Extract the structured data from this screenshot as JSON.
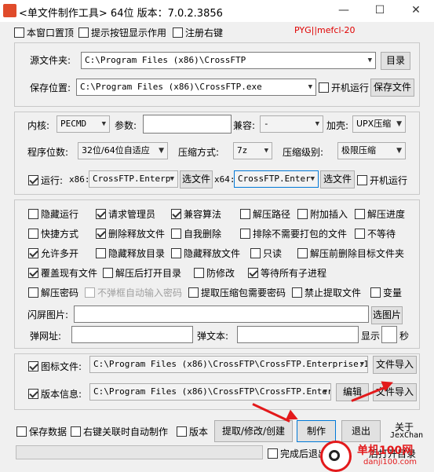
{
  "window": {
    "title": "<单文件制作工具> 64位 版本：7.0.2.3856",
    "minimize": "—",
    "maximize": "☐",
    "close": "✕"
  },
  "top_options": {
    "stay_on_top": "本窗口置顶",
    "show_tips": "提示按钮显示作用",
    "register_context": "注册右键",
    "credit": "PYG||mefcl-20"
  },
  "source": {
    "source_label": "源文件夹:",
    "source_value": "C:\\Program Files (x86)\\CrossFTP",
    "browse_button": "目录",
    "save_label": "保存位置:",
    "save_value": "C:\\Program Files (x86)\\CrossFTP.exe",
    "autorun_label": "开机运行",
    "save_file_button": "保存文件"
  },
  "kernel": {
    "kernel_label": "内核:",
    "kernel_value": "PECMD",
    "params_label": "参数:",
    "params_value": "",
    "compat_label": "兼容:",
    "compat_value": "-",
    "shell_label": "加壳:",
    "shell_value": "UPX压缩",
    "bits_label": "程序位数:",
    "bits_value": "32位/64位自适应",
    "compress_label": "压缩方式:",
    "compress_value": "7z",
    "level_label": "压缩级别:",
    "level_value": "极限压缩",
    "run_label": "运行:",
    "x86_label": "x86:",
    "x86_value": "CrossFTP.Enterp",
    "x86_button": "选文件",
    "x64_label": "x64:",
    "x64_value": "CrossFTP.Enter",
    "x64_button": "选文件",
    "run_autorun": "开机运行"
  },
  "options": {
    "row1": [
      "隐藏运行",
      "请求管理员",
      "兼容算法",
      "解压路径",
      "附加插入",
      "解压进度"
    ],
    "row2": [
      "快捷方式",
      "删除释放文件",
      "自我删除",
      "排除不需要打包的文件",
      "不等待"
    ],
    "row3": [
      "允许多开",
      "隐藏释放目录",
      "隐藏释放文件",
      "只读",
      "解压前删除目标文件夹"
    ],
    "row4": [
      "覆盖现有文件",
      "解压后打开目录",
      "防修改",
      "等待所有子进程"
    ],
    "row5": [
      "解压密码",
      "不弹框自动输入密码",
      "提取压缩包需要密码",
      "禁止提取文件",
      "变量"
    ],
    "flash_label": "闪屏图片:",
    "flash_value": "",
    "flash_button": "选图片",
    "popup_url_label": "弹网址:",
    "popup_url_value": "",
    "popup_text_label": "弹文本:",
    "popup_text_value": "",
    "show_label": "显示",
    "show_value": "",
    "seconds_label": "秒"
  },
  "files": {
    "icon_label": "图标文件:",
    "icon_value": "C:\\Program Files (x86)\\CrossFTP\\CrossFTP.Enterprise.1.9",
    "icon_button": "文件导入",
    "version_label": "版本信息:",
    "version_value": "C:\\Program Files (x86)\\CrossFTP\\CrossFTP.Enterpr",
    "edit_button": "编辑",
    "version_button": "文件导入"
  },
  "bottom": {
    "save_data": "保存数据",
    "ctx_auto": "右键关联时自动制作",
    "version": "版本",
    "extract_button": "提取/修改/创建",
    "make_button": "制作",
    "exit_button": "退出",
    "about": "关于",
    "author": "JexChan",
    "after_done": "完成后退出",
    "open_dir": "后打开目录",
    "watermark": "单机100网",
    "watermark_url": "danji100.com"
  },
  "colors": {
    "credit": "#e00000",
    "arrow": "#e3191b",
    "focus_border": "#0078d7"
  }
}
